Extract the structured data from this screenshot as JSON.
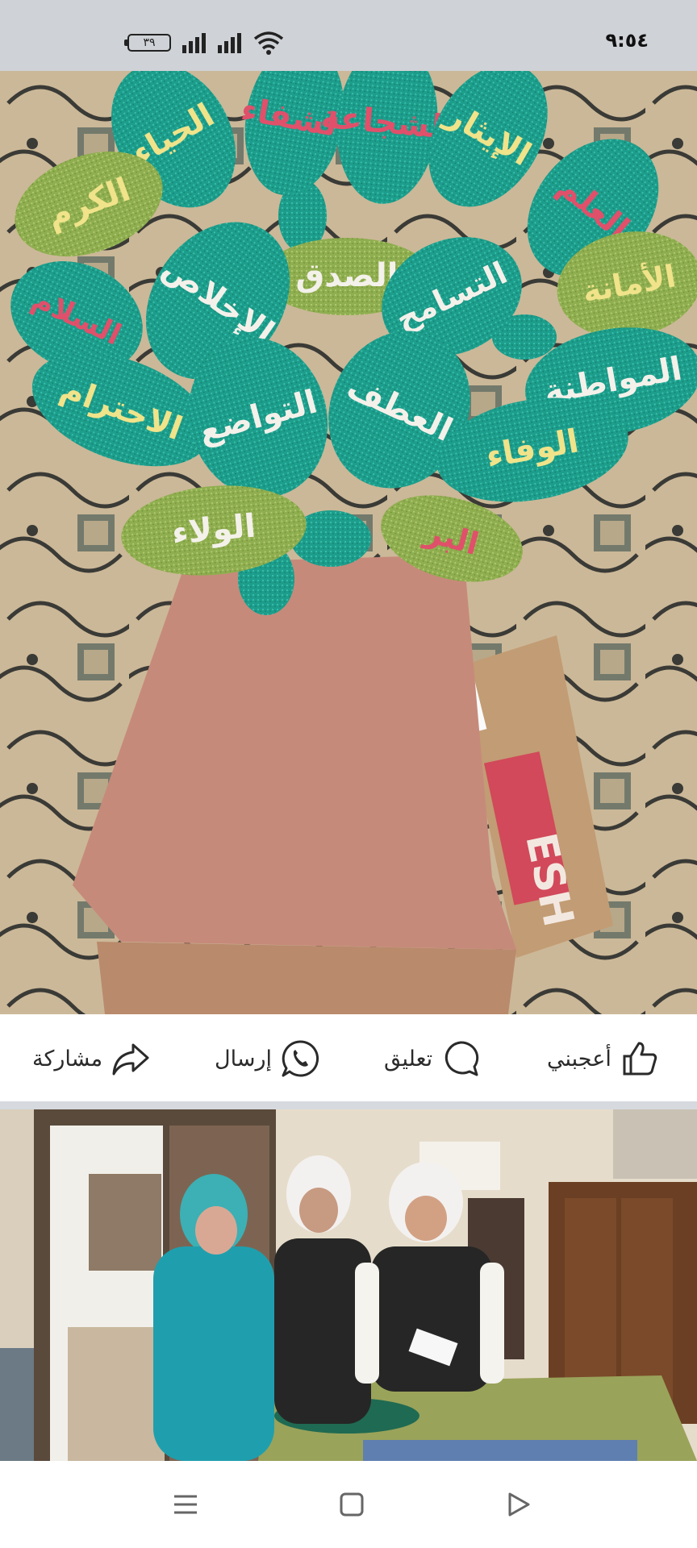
{
  "status_bar": {
    "time": "٩:٥٤",
    "battery": "٣٩",
    "icons": [
      "battery-icon",
      "signal-icon",
      "signal-icon",
      "wifi-icon"
    ]
  },
  "post_image": {
    "leaf_words": [
      "الحياء",
      "الشفاء",
      "الشجاعة",
      "الإيثار",
      "العلم",
      "الكرم",
      "الصدق",
      "التسامح",
      "الأمانة",
      "السلام",
      "الإخلاص",
      "المواطنة",
      "الاحترام",
      "التواضع",
      "العطف",
      "الوفاء",
      "الولاء",
      "البر"
    ],
    "box_text": "ESH"
  },
  "actions": {
    "like": "أعجبني",
    "comment": "تعليق",
    "send": "إرسال",
    "share": "مشاركة"
  },
  "colors": {
    "status_bg": "#cfd2d6",
    "leaf_teal": "#1f9e8c",
    "leaf_green": "#8db04a",
    "trunk": "#c98e7e"
  },
  "nav": {
    "icons": [
      "menu-icon",
      "home-icon",
      "back-icon"
    ]
  }
}
